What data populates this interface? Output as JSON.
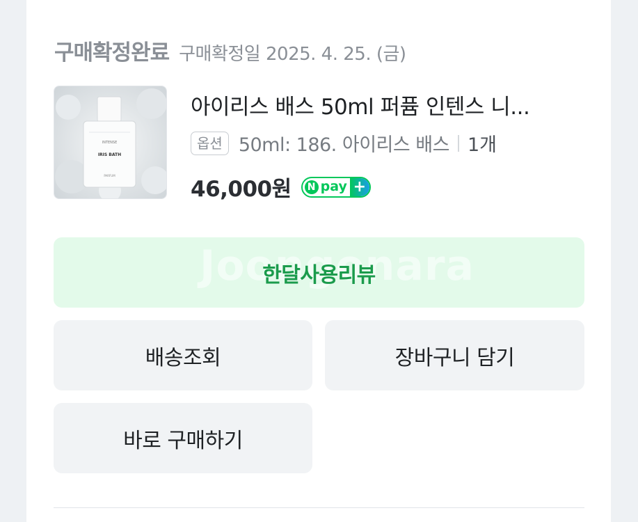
{
  "order": {
    "status_title": "구매확정완료",
    "status_date": "구매확정일 2025. 4. 25. (금)"
  },
  "product": {
    "name": "아이리스 배스 50ml 퍼퓸 인텐스 니...",
    "option_badge": "옵션",
    "option_value": "50ml: 186. 아이리스 배스",
    "quantity": "1개",
    "price": "46,000원",
    "image_brand": "INTENSE",
    "image_label": "IRIS BATH",
    "image_sub": "PARFUM"
  },
  "npay": {
    "n": "N",
    "pay": "pay",
    "plus": "+"
  },
  "watermark": "Joongonara",
  "actions": {
    "review": "한달사용리뷰",
    "delivery": "배송조회",
    "cart": "장바구니 담기",
    "buy_now": "바로 구매하기"
  },
  "colors": {
    "review_bg": "#e3faea",
    "review_text": "#1b9b4c",
    "npay_green": "#03c75a",
    "button_bg": "#f1f3f5"
  }
}
